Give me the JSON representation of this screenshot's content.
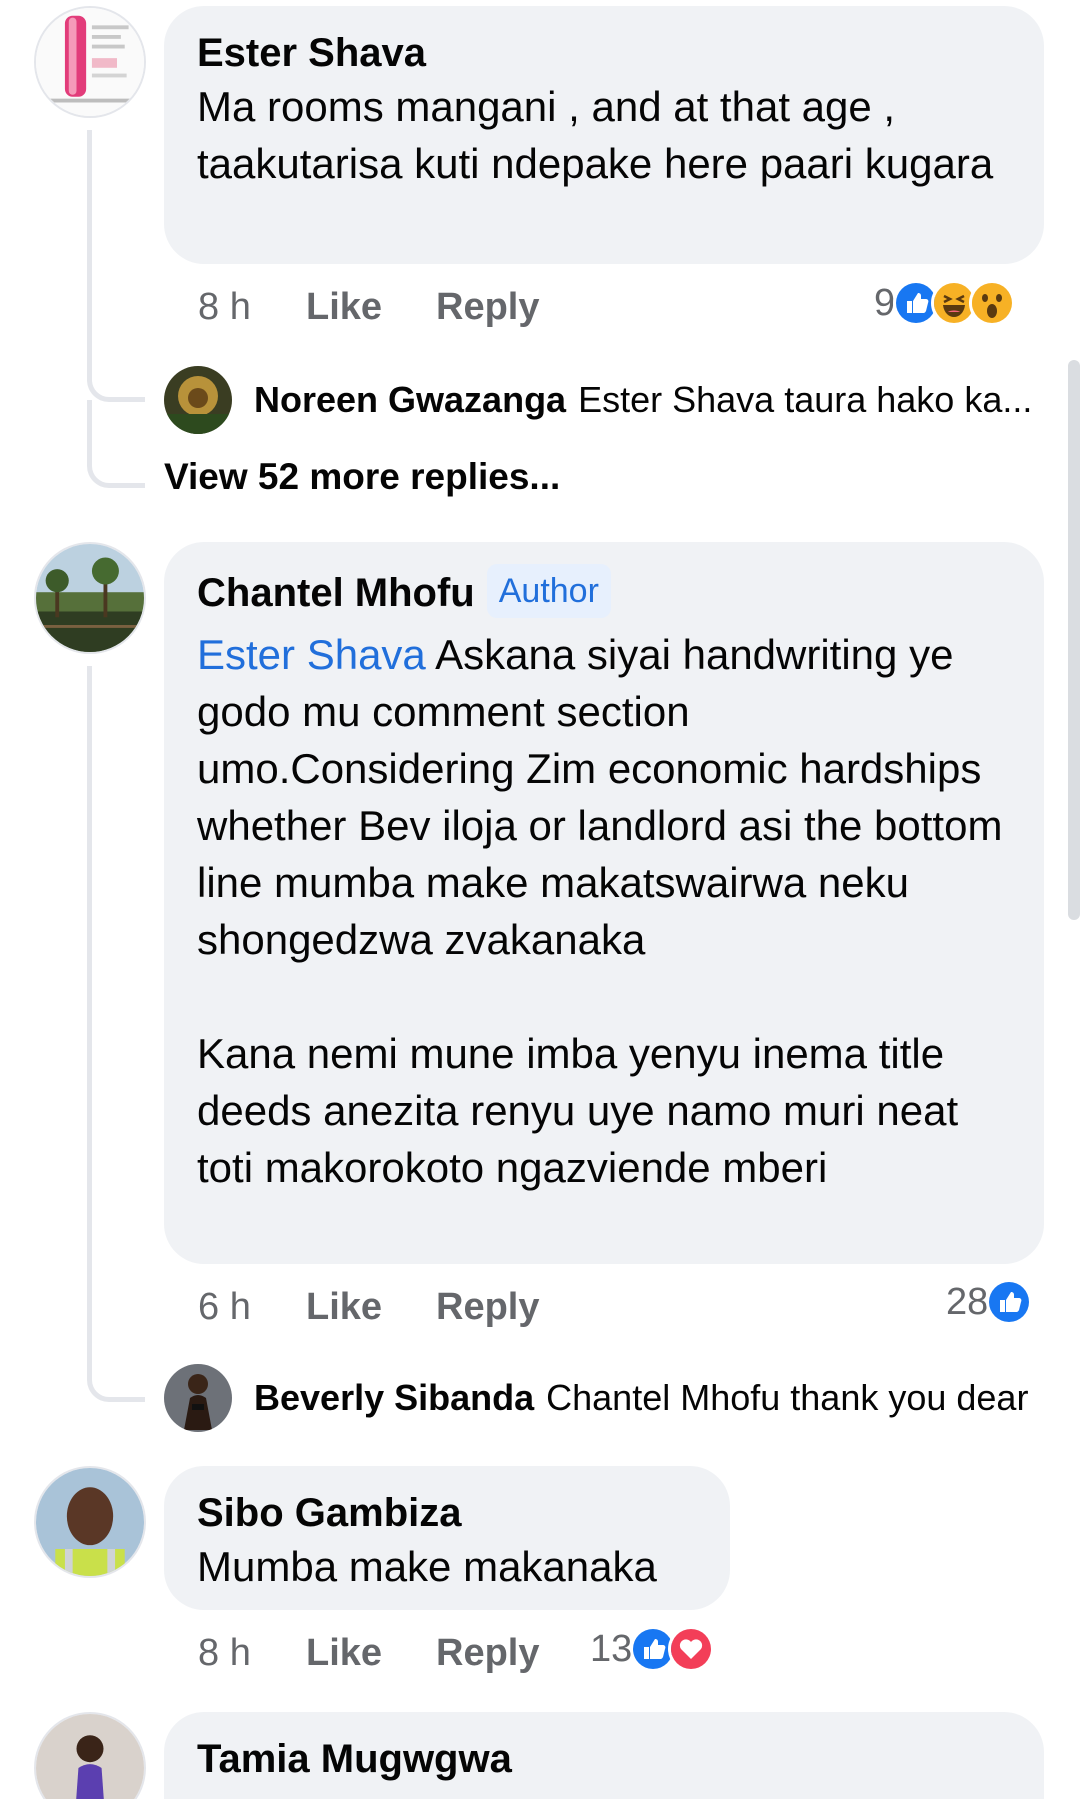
{
  "comments": [
    {
      "name": "Ester Shava",
      "text": "Ma rooms mangani , and at that age , taakutarisa kuti ndepake here paari kugara",
      "time": "8 h",
      "like_label": "Like",
      "reply_label": "Reply",
      "reaction_count": "9",
      "reactions": [
        "like",
        "haha",
        "wow"
      ],
      "replies": [
        {
          "name": "Noreen Gwazanga",
          "text": "Ester Shava taura hako ka..."
        }
      ],
      "view_more": "View 52 more replies..."
    },
    {
      "name": "Chantel Mhofu",
      "badge": "Author",
      "mention": "Ester Shava",
      "text": " Askana siyai handwriting ye godo mu comment section umo.Considering Zim economic hardships whether Bev iloja or landlord asi the bottom line mumba make makatswairwa neku shongedzwa zvakanaka\n\nKana nemi mune imba yenyu inema title deeds anezita renyu uye namo muri neat toti makorokoto ngazviende mberi",
      "time": "6 h",
      "like_label": "Like",
      "reply_label": "Reply",
      "reaction_count": "28",
      "reactions": [
        "like"
      ],
      "replies": [
        {
          "name": "Beverly Sibanda",
          "text": "Chantel Mhofu thank you dear"
        }
      ]
    },
    {
      "name": "Sibo Gambiza",
      "text": "Mumba make makanaka",
      "time": "8 h",
      "like_label": "Like",
      "reply_label": "Reply",
      "reaction_count": "13",
      "reactions": [
        "like",
        "love"
      ]
    },
    {
      "name": "Tamia Mugwgwa"
    }
  ],
  "colors": {
    "bubble": "#f0f2f5",
    "link": "#216fdb",
    "meta": "#65676b",
    "like": "#1877f2",
    "love": "#f33e58",
    "haha": "#f7b125"
  }
}
